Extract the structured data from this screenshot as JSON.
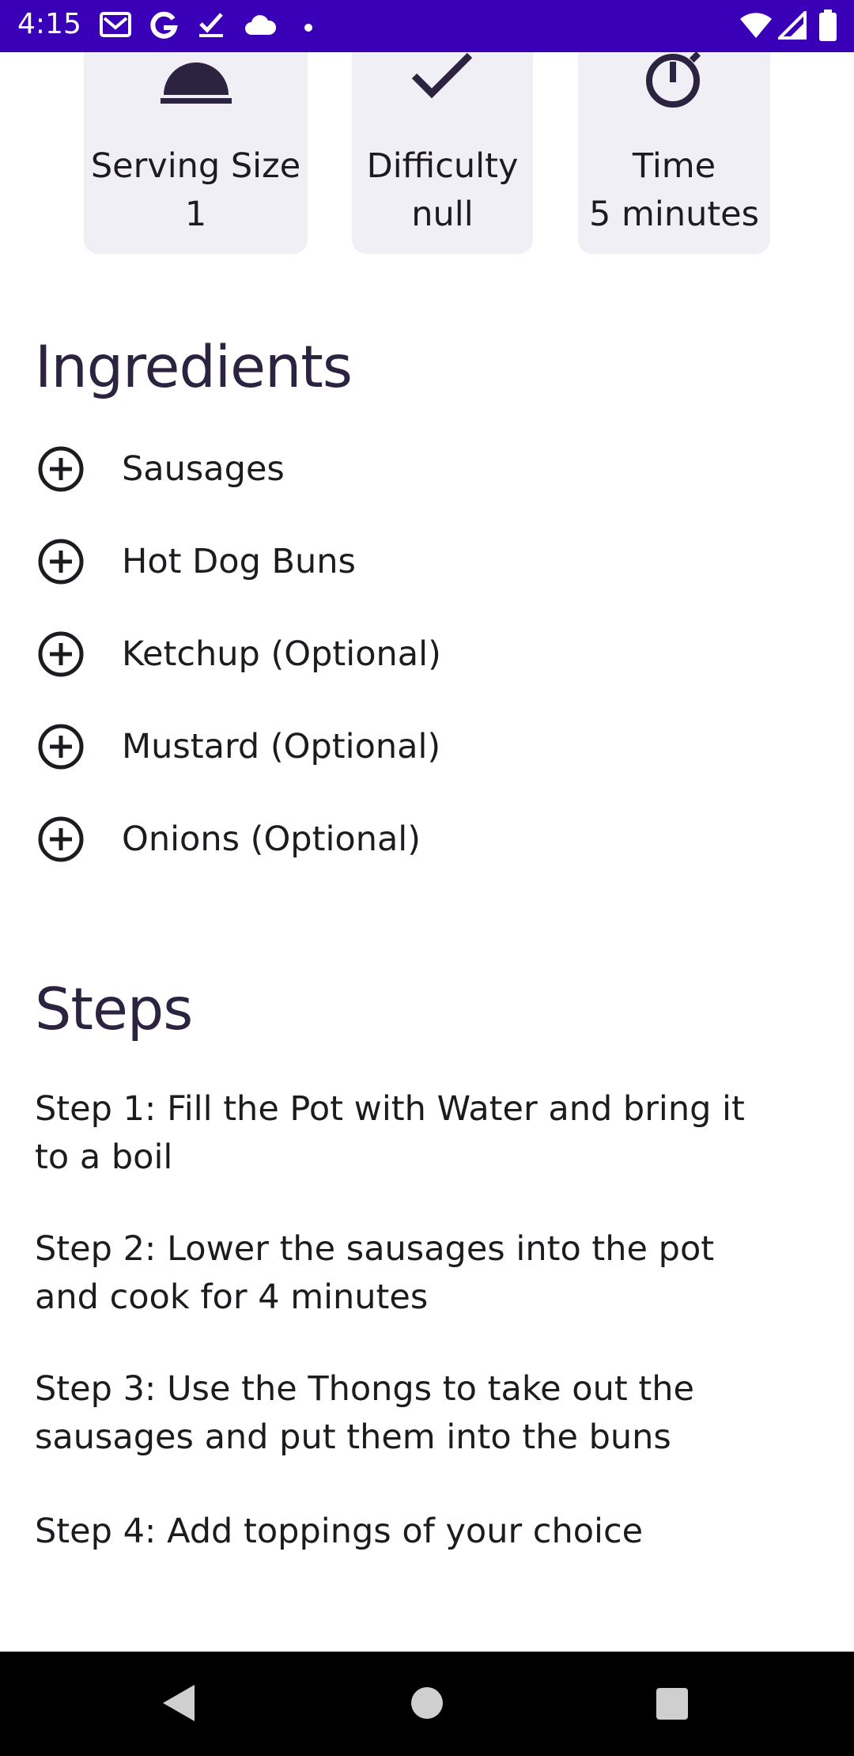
{
  "status_bar": {
    "time": "4:15",
    "icons": [
      "gmail-icon",
      "google-icon",
      "task-check-icon",
      "cloud-icon",
      "dot-icon",
      "wifi-icon",
      "signal-icon",
      "battery-icon"
    ],
    "background": "#3a00b8"
  },
  "info_cards": [
    {
      "icon": "serving-cloche-icon",
      "label": "Serving Size",
      "value": "1"
    },
    {
      "icon": "check-icon",
      "label": "Difficulty",
      "value": "null"
    },
    {
      "icon": "timer-icon",
      "label": "Time",
      "value": "5 minutes"
    }
  ],
  "ingredients": {
    "title": "Ingredients",
    "items": [
      {
        "label": "Sausages"
      },
      {
        "label": "Hot Dog Buns"
      },
      {
        "label": "Ketchup (Optional)"
      },
      {
        "label": "Mustard (Optional)"
      },
      {
        "label": "Onions (Optional)"
      }
    ]
  },
  "steps": {
    "title": "Steps",
    "items": [
      {
        "text": "Step 1: Fill the Pot with Water and bring it to a boil"
      },
      {
        "text": "Step 2: Lower the sausages into the pot and cook for 4 minutes"
      },
      {
        "text": "Step 3: Use the Thongs to take out the sausages and put them into the buns"
      },
      {
        "text": "Step 4: Add toppings of your choice"
      }
    ]
  },
  "nav_bar": {
    "buttons": [
      "back-icon",
      "home-icon",
      "recents-icon"
    ]
  },
  "colors": {
    "accent": "#3a00b8",
    "heading": "#2b2340",
    "card_bg": "#f1eff6"
  }
}
